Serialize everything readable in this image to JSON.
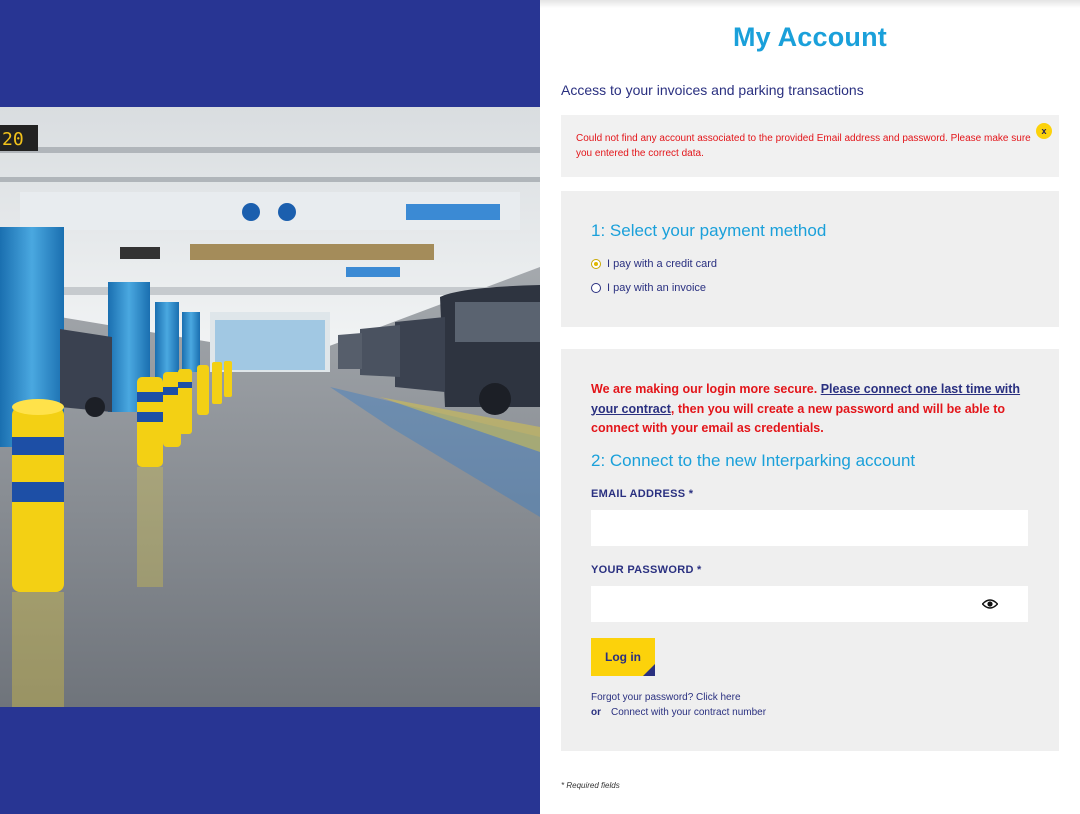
{
  "page": {
    "title": "My Account",
    "subtitle": "Access to your invoices and parking transactions"
  },
  "alert": {
    "message": "Could not find any account associated to the provided Email address and password. Please make sure you entered the correct data.",
    "close_label": "x"
  },
  "payment": {
    "title": "1: Select your payment method",
    "options": [
      {
        "label": "I pay with a credit card",
        "selected": true
      },
      {
        "label": "I pay with an invoice",
        "selected": false
      }
    ]
  },
  "login": {
    "notice_before": "We are making our login more secure. ",
    "notice_link": "Please connect one last time with your contract",
    "notice_after": ", then you will create a new password and will be able to connect with your email as credentials.",
    "title": "2: Connect to the new Interparking account",
    "email_label": "EMAIL ADDRESS *",
    "email_value": "",
    "password_label": "YOUR PASSWORD *",
    "password_value": "",
    "button_label": "Log in",
    "forgot_text": "Forgot your password? Click here",
    "or_text": "or",
    "contract_link": "Connect with your contract number"
  },
  "footer": {
    "required": "* Required fields"
  },
  "colors": {
    "brand_blue": "#283593",
    "accent_cyan": "#1aa0da",
    "error_red": "#e3151a",
    "button_yellow": "#fcd20b"
  },
  "icons": {
    "password_toggle": "eye-icon",
    "alert_close": "close-icon"
  }
}
